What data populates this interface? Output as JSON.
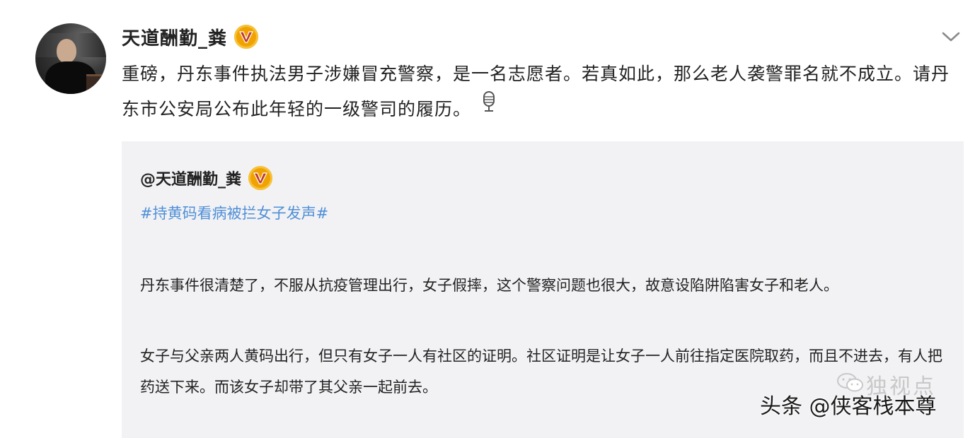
{
  "post": {
    "username": "天道酬勤_粪",
    "text": "重磅，丹东事件执法男子涉嫌冒充警察，是一名志愿者。若真如此，那么老人袭警罪名就不成立。请丹东市公安局公布此年轻的一级警司的履历。",
    "avatar_icon": "speaker-avatar",
    "badge_icon": "verified-v-badge",
    "menu_icon": "chevron-down-icon",
    "voice_icon": "microphone-icon"
  },
  "quote": {
    "username": "@天道酬勤_粪",
    "hashtag": "#持黄码看病被拦女子发声#",
    "paragraphs": [
      "丹东事件很清楚了，不服从抗疫管理出行，女子假摔，这个警察问题也很大，故意设陷阱陷害女子和老人。",
      "女子与父亲两人黄码出行，但只有女子一人有社区的证明。社区证明是让女子一人前往指定医院取药，而且不进去，有人把药送下来。而该女子却带了其父亲一起前去。"
    ]
  },
  "watermark": {
    "front": "头条 @侠客栈本尊",
    "back": "独视点"
  },
  "colors": {
    "badge": "#f0a300",
    "hashtag": "#4f8fd6",
    "quote_bg": "#f2f2f5"
  }
}
